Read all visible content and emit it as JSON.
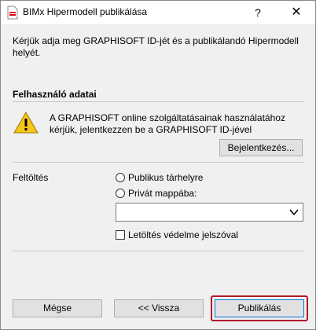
{
  "window": {
    "title": "BIMx Hipermodell publikálása"
  },
  "titlebar": {
    "help_glyph": "?",
    "close_glyph": "✕"
  },
  "intro": {
    "text": "Kérjük adja meg GRAPHISOFT ID-jét és a publikálandó Hipermodell helyét."
  },
  "user_section": {
    "title": "Felhasználó adatai",
    "warning_text": "A GRAPHISOFT online szolgáltatásainak használatához kérjük, jelentkezzen be a GRAPHISOFT ID-jével",
    "login_button": "Bejelentkezés..."
  },
  "upload_section": {
    "label": "Feltöltés",
    "option_public": "Publikus tárhelyre",
    "option_private": "Privát mappába:",
    "folder_select_value": "",
    "protect_label": "Letöltés védelme jelszóval"
  },
  "buttons": {
    "cancel": "Mégse",
    "back": "<< Vissza",
    "publish": "Publikálás"
  },
  "colors": {
    "highlight_border": "#b0182a",
    "default_button_border": "#0078d7",
    "warning_yellow": "#f5c518"
  },
  "icons": {
    "app": "bimx-app-icon",
    "help": "help-icon",
    "close": "close-icon",
    "warning": "warning-icon",
    "dropdown": "chevron-down-icon"
  }
}
